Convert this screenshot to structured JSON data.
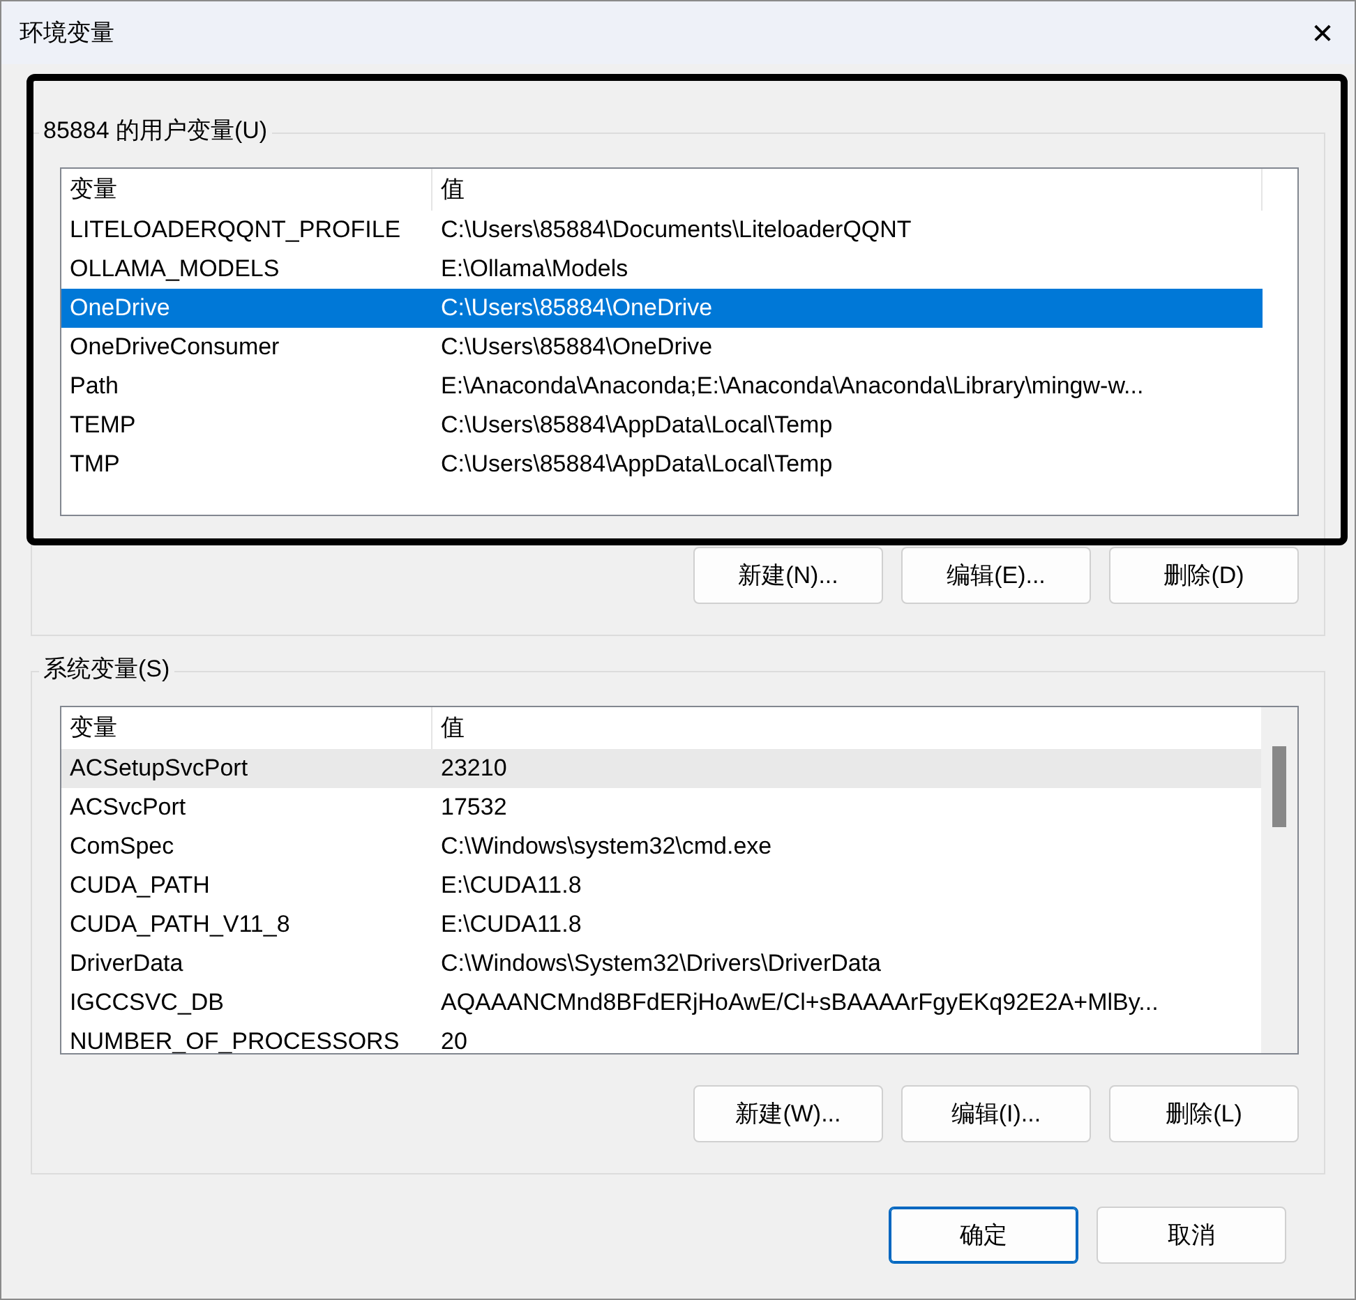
{
  "window": {
    "title": "环境变量",
    "close": "✕"
  },
  "highlight_frame": true,
  "user_variables": {
    "label": "85884 的用户变量(U)",
    "columns": [
      "变量",
      "值"
    ],
    "rows": [
      {
        "name": "LITELOADERQQNT_PROFILE",
        "value": "C:\\Users\\85884\\Documents\\LiteloaderQQNT",
        "selected": false
      },
      {
        "name": "OLLAMA_MODELS",
        "value": "E:\\Ollama\\Models",
        "selected": false
      },
      {
        "name": "OneDrive",
        "value": "C:\\Users\\85884\\OneDrive",
        "selected": true
      },
      {
        "name": "OneDriveConsumer",
        "value": "C:\\Users\\85884\\OneDrive",
        "selected": false
      },
      {
        "name": "Path",
        "value": "E:\\Anaconda\\Anaconda;E:\\Anaconda\\Anaconda\\Library\\mingw-w...",
        "selected": false
      },
      {
        "name": "TEMP",
        "value": "C:\\Users\\85884\\AppData\\Local\\Temp",
        "selected": false
      },
      {
        "name": "TMP",
        "value": "C:\\Users\\85884\\AppData\\Local\\Temp",
        "selected": false
      }
    ],
    "buttons": [
      "新建(N)...",
      "编辑(E)...",
      "删除(D)"
    ]
  },
  "system_variables": {
    "label": "系统变量(S)",
    "columns": [
      "变量",
      "值"
    ],
    "rows": [
      {
        "name": "ACSetupSvcPort",
        "value": "23210",
        "selected": false,
        "hovered": true
      },
      {
        "name": "ACSvcPort",
        "value": "17532",
        "selected": false,
        "hovered": false
      },
      {
        "name": "ComSpec",
        "value": "C:\\Windows\\system32\\cmd.exe",
        "selected": false,
        "hovered": false
      },
      {
        "name": "CUDA_PATH",
        "value": "E:\\CUDA11.8",
        "selected": false,
        "hovered": false
      },
      {
        "name": "CUDA_PATH_V11_8",
        "value": "E:\\CUDA11.8",
        "selected": false,
        "hovered": false
      },
      {
        "name": "DriverData",
        "value": "C:\\Windows\\System32\\Drivers\\DriverData",
        "selected": false,
        "hovered": false
      },
      {
        "name": "IGCCSVC_DB",
        "value": "AQAAANCMnd8BFdERjHoAwE/Cl+sBAAAArFgyEKq92E2A+MlBy...",
        "selected": false,
        "hovered": false
      },
      {
        "name": "NUMBER_OF_PROCESSORS",
        "value": "20",
        "selected": false,
        "hovered": false
      }
    ],
    "buttons": [
      "新建(W)...",
      "编辑(I)...",
      "删除(L)"
    ]
  },
  "footer_buttons": [
    {
      "label": "确定",
      "kind": "default"
    },
    {
      "label": "取消",
      "kind": "normal"
    }
  ]
}
